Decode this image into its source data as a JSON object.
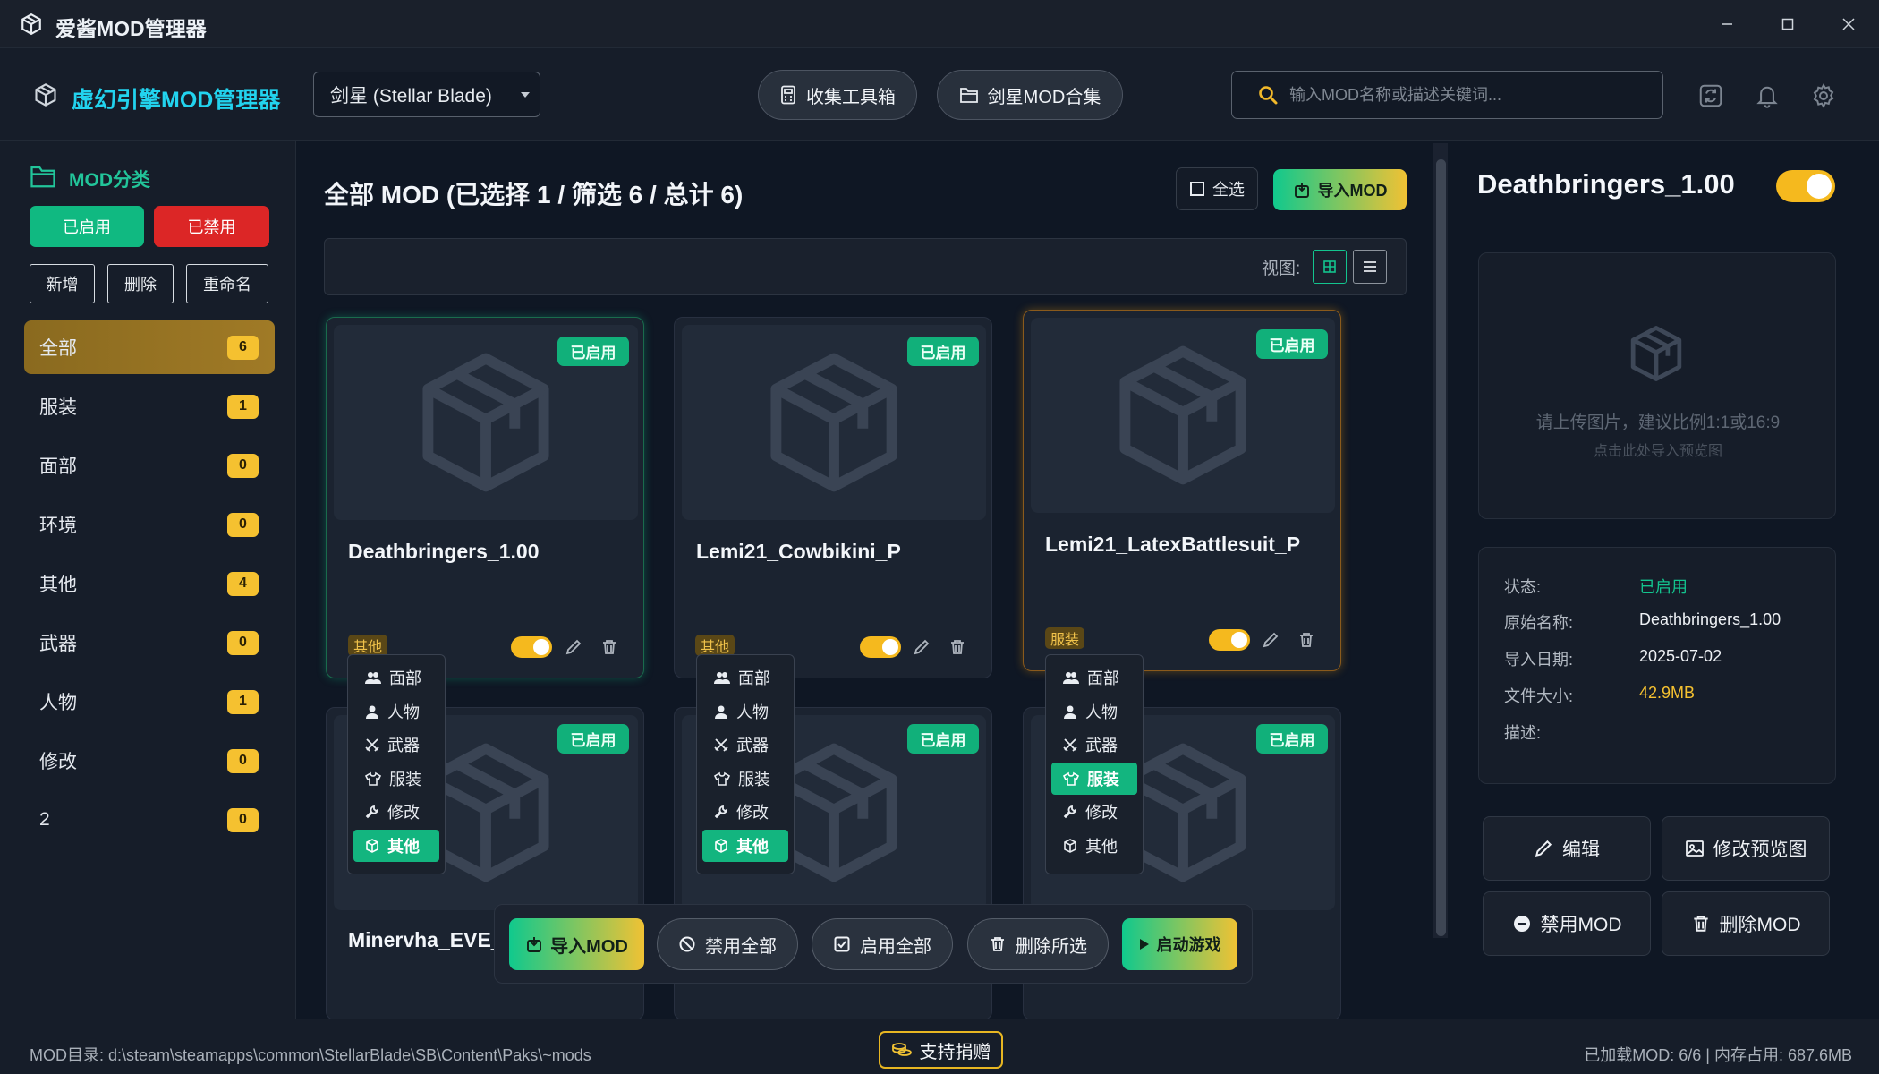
{
  "window": {
    "title": "爱酱MOD管理器"
  },
  "header": {
    "brand": "虚幻引擎MOD管理器",
    "game_select": "剑星 (Stellar Blade)",
    "toolbox_label": "收集工具箱",
    "collection_label": "剑星MOD合集",
    "search_placeholder": "输入MOD名称或描述关键词..."
  },
  "sidebar": {
    "title": "MOD分类",
    "enabled_label": "已启用",
    "disabled_label": "已禁用",
    "add_label": "新增",
    "delete_label": "删除",
    "rename_label": "重命名",
    "categories": [
      {
        "label": "全部",
        "count": "6"
      },
      {
        "label": "服装",
        "count": "1"
      },
      {
        "label": "面部",
        "count": "0"
      },
      {
        "label": "环境",
        "count": "0"
      },
      {
        "label": "其他",
        "count": "4"
      },
      {
        "label": "武器",
        "count": "0"
      },
      {
        "label": "人物",
        "count": "1"
      },
      {
        "label": "修改",
        "count": "0"
      },
      {
        "label": "2",
        "count": "0"
      }
    ],
    "active_category": "全部"
  },
  "main": {
    "title": "全部 MOD (已选择 1 / 筛选 6 / 总计 6)",
    "select_all_label": "全选",
    "import_label": "导入MOD",
    "view_label": "视图:",
    "cards": [
      {
        "name": "Deathbringers_1.00",
        "status": "已启用",
        "tag": "其他",
        "enabled": true
      },
      {
        "name": "Lemi21_Cowbikini_P",
        "status": "已启用",
        "tag": "其他",
        "enabled": true
      },
      {
        "name": "Lemi21_LatexBattlesuit_P",
        "status": "已启用",
        "tag": "服装",
        "enabled": true
      },
      {
        "name": "Minervha_EVE_",
        "status": "已启用"
      },
      {
        "name": "",
        "status": "已启用"
      },
      {
        "name": "",
        "status": "已启用"
      }
    ],
    "category_menu": [
      "面部",
      "人物",
      "武器",
      "服装",
      "修改",
      "其他"
    ],
    "menu_selected": [
      "其他",
      "其他",
      "服装"
    ]
  },
  "toolbar": {
    "import_label": "导入MOD",
    "disable_all_label": "禁用全部",
    "enable_all_label": "启用全部",
    "delete_selected_label": "删除所选",
    "launch_label": "启动游戏"
  },
  "detail": {
    "title": "Deathbringers_1.00",
    "enabled": true,
    "upload_hint": "请上传图片，建议比例1:1或16:9",
    "upload_subhint": "点击此处导入预览图",
    "status_label": "状态:",
    "status_value": "已启用",
    "origname_label": "原始名称:",
    "origname_value": "Deathbringers_1.00",
    "date_label": "导入日期:",
    "date_value": "2025-07-02",
    "size_label": "文件大小:",
    "size_value": "42.9MB",
    "desc_label": "描述:",
    "edit_label": "编辑",
    "edit_preview_label": "修改预览图",
    "disable_label": "禁用MOD",
    "delete_label": "删除MOD"
  },
  "statusbar": {
    "mod_dir": "MOD目录: d:\\steam\\steamapps\\common\\StellarBlade\\SB\\Content\\Paks\\~mods",
    "donate_label": "支持捐赠",
    "summary": "已加载MOD: 6/6 | 内存占用: 687.6MB"
  },
  "colors": {
    "accent_green": "#11b07a",
    "accent_yellow": "#f5c130",
    "danger_red": "#dc2626",
    "brand_cyan": "#22d3ee"
  }
}
